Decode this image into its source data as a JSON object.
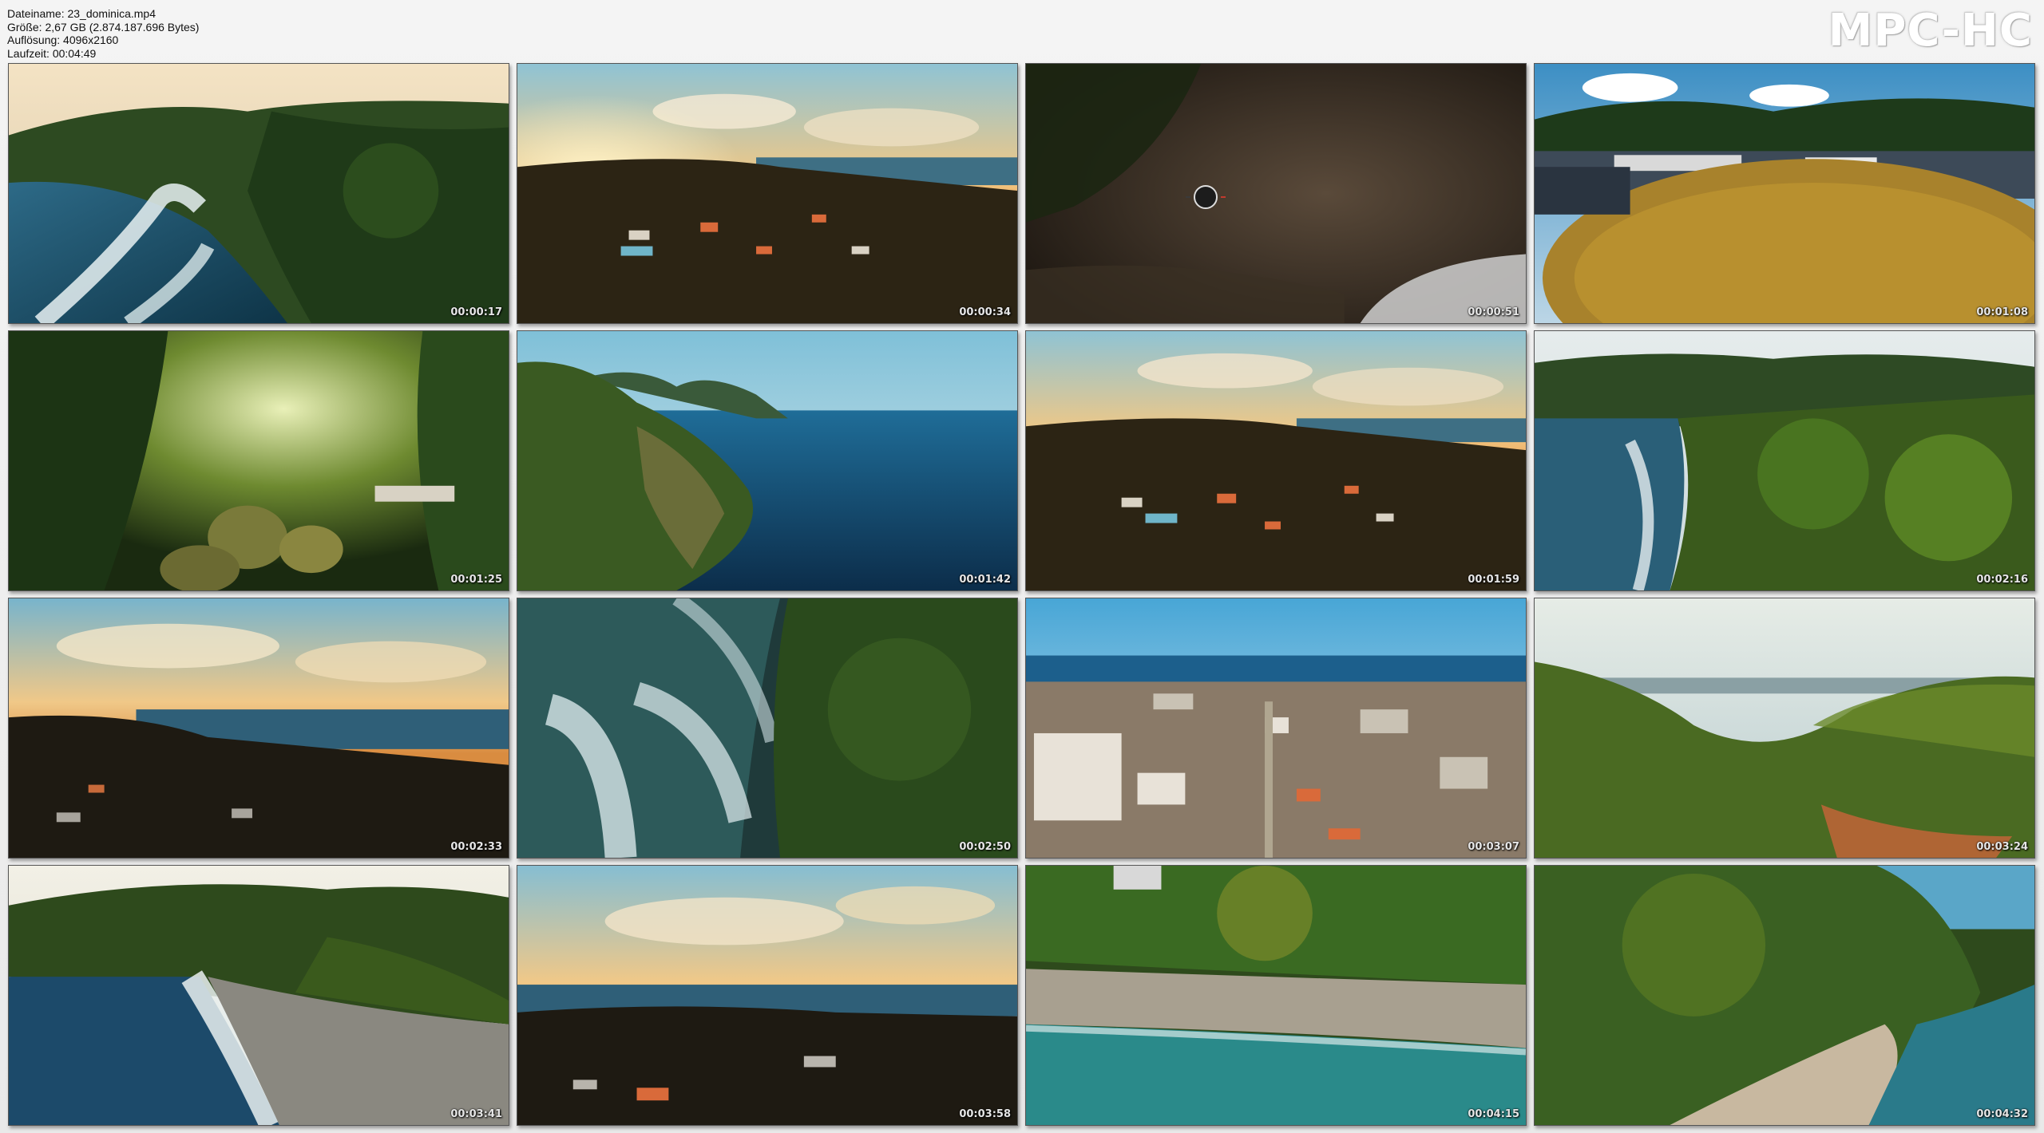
{
  "header": {
    "file_name": "Dateiname: 23_dominica.mp4",
    "size": "Größe: 2,67 GB (2.874.187.696 Bytes)",
    "resolution": "Auflösung: 4096x2160",
    "duration": "Laufzeit: 00:04:49"
  },
  "logo": "MPC-HC",
  "colors": {
    "background": "#efefef",
    "logo": "#ffffff",
    "watermark_red": "#c23a2e"
  },
  "watermark": {
    "left": "",
    "right": ""
  },
  "thumbnails": [
    {
      "time": "00:00:17"
    },
    {
      "time": "00:00:34"
    },
    {
      "time": "00:00:51"
    },
    {
      "time": "00:01:08"
    },
    {
      "time": "00:01:25"
    },
    {
      "time": "00:01:42"
    },
    {
      "time": "00:01:59"
    },
    {
      "time": "00:02:16"
    },
    {
      "time": "00:02:33"
    },
    {
      "time": "00:02:50"
    },
    {
      "time": "00:03:07"
    },
    {
      "time": "00:03:24"
    },
    {
      "time": "00:03:41"
    },
    {
      "time": "00:03:58"
    },
    {
      "time": "00:04:15"
    },
    {
      "time": "00:04:32"
    }
  ]
}
